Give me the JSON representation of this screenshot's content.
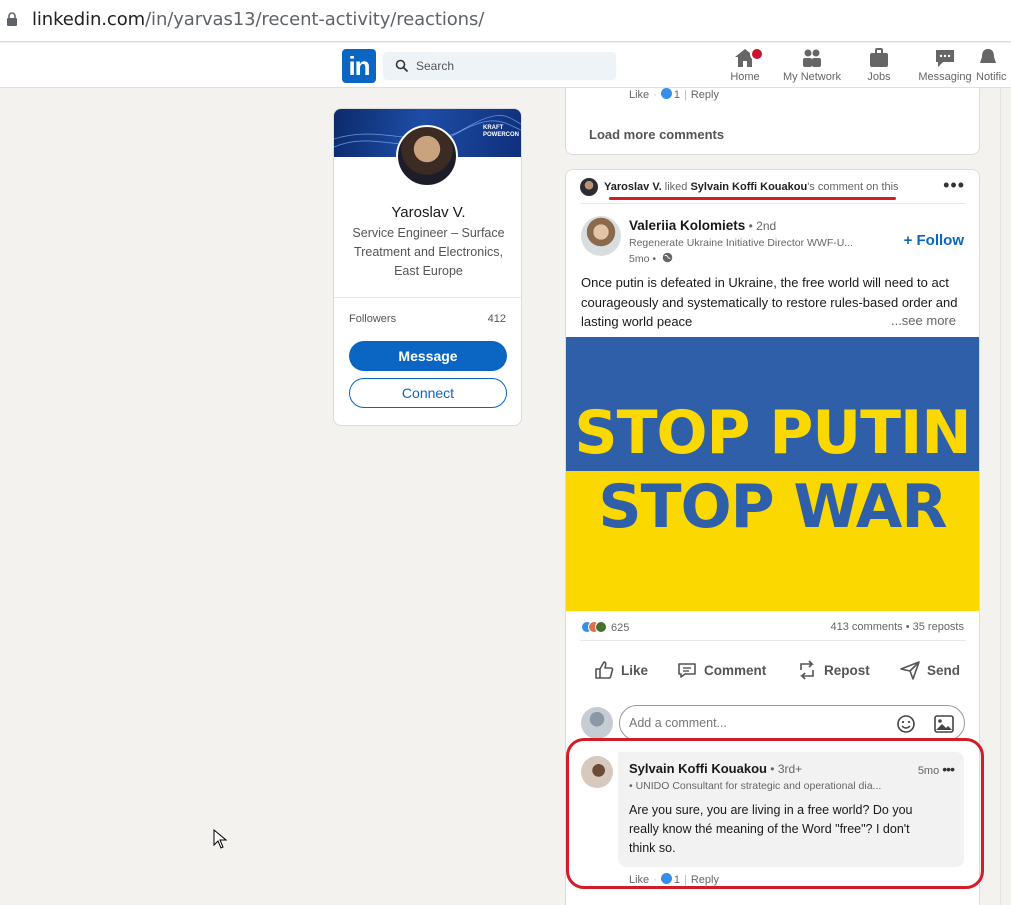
{
  "browser": {
    "url_host": "linkedin.com",
    "url_path": "/in/yarvas13/recent-activity/reactions/"
  },
  "nav": {
    "logo": "in",
    "search_placeholder": "Search",
    "items": [
      {
        "label": "Home",
        "icon": "home-icon"
      },
      {
        "label": "My Network",
        "icon": "network-icon"
      },
      {
        "label": "Jobs",
        "icon": "briefcase-icon"
      },
      {
        "label": "Messaging",
        "icon": "messaging-icon"
      },
      {
        "label": "Notific",
        "icon": "bell-icon"
      }
    ]
  },
  "profile": {
    "banner_logo": "KRAFT POWERCON",
    "name": "Yaroslav V.",
    "headline": "Service Engineer – Surface Treatment and Electronics, East Europe",
    "followers_label": "Followers",
    "followers_count": "412",
    "message_label": "Message",
    "connect_label": "Connect"
  },
  "prev_card": {
    "like": "Like",
    "like_count": "1",
    "reply": "Reply",
    "load_more": "Load more comments"
  },
  "post": {
    "context_actor": "Yaroslav V.",
    "context_verb": " liked ",
    "context_target": "Sylvain Koffi Kouakou",
    "context_tail": "'s comment on this",
    "author_name": "Valeriia Kolomiets",
    "author_degree": " • 2nd",
    "author_headline": "Regenerate Ukraine Initiative Director WWF-U...",
    "author_time": "5mo •",
    "follow_label": "+ Follow",
    "text": "Once putin is defeated in Ukraine, the free world will need to act courageously and systematically to restore rules-based order and lasting world peace",
    "see_more": "...see more",
    "image_line1": "STOP PUTIN",
    "image_line2": "STOP WAR",
    "reaction_count": "625",
    "counts": "413 comments • 35 reposts",
    "actions": {
      "like": "Like",
      "comment": "Comment",
      "repost": "Repost",
      "send": "Send"
    },
    "comment_placeholder": "Add a comment..."
  },
  "comment": {
    "name": "Sylvain Koffi Kouakou",
    "degree": " • 3rd+",
    "headline": "• UNIDO Consultant for strategic and operational dia...",
    "time": "5mo",
    "text": "Are you sure, you are living in a free world? Do you really know thé meaning of the Word \"free\"? I don't think so.",
    "like": "Like",
    "like_count": "1",
    "reply": "Reply"
  },
  "colors": {
    "brand": "#0a66c2",
    "highlight": "#d11d28",
    "flag_blue": "#2e5fa8",
    "flag_yellow": "#fbd800"
  }
}
